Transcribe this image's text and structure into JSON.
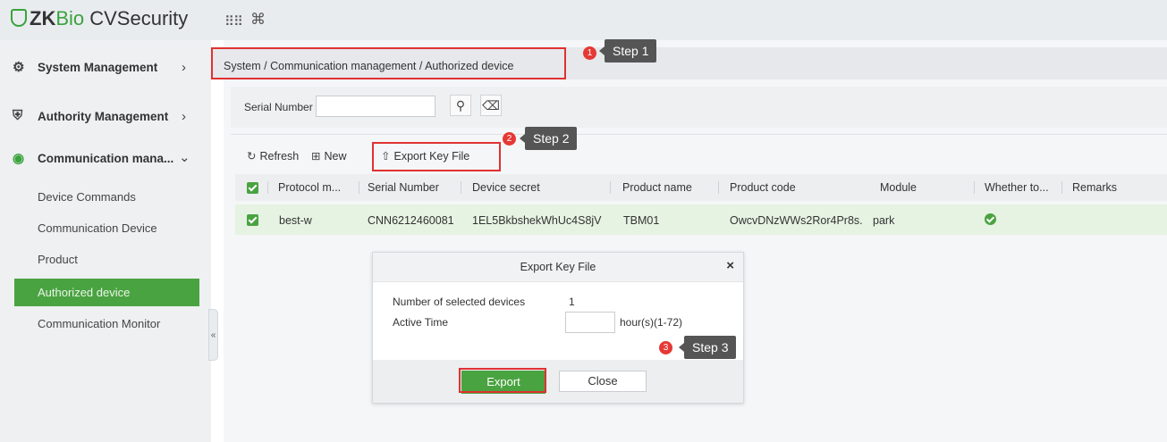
{
  "app": {
    "logo_zk": "ZK",
    "logo_bio": "Bio",
    "logo_rest": " CVSecurity",
    "grid_icon": "⠿⠿",
    "cmd_icon": "⌘"
  },
  "sidebar": {
    "menus": [
      {
        "label": "System Management",
        "icon": "gear-icon",
        "chevron": "›"
      },
      {
        "label": "Authority Management",
        "icon": "shield-icon",
        "chevron": "›"
      },
      {
        "label": "Communication mana...",
        "icon": "broadcast-icon",
        "chevron": "⌄"
      }
    ],
    "submenu": [
      {
        "label": "Device Commands"
      },
      {
        "label": "Communication Device"
      },
      {
        "label": "Product"
      },
      {
        "label": "Authorized device"
      },
      {
        "label": "Communication Monitor"
      }
    ],
    "collapse_label": "«"
  },
  "breadcrumb": "System / Communication management / Authorized device",
  "search": {
    "serial_label": "Serial Number",
    "serial_value": "",
    "search_icon": "⚲",
    "clear_icon": "⌫"
  },
  "toolbar": {
    "refresh": "Refresh",
    "new": "New",
    "export": "Export Key File"
  },
  "table": {
    "columns": [
      "Protocol m...",
      "Serial Number",
      "Device secret",
      "Product name",
      "Product code",
      "Module",
      "Whether to...",
      "Remarks"
    ],
    "rows": [
      {
        "protocol": "best-w",
        "serial": "CNN6212460081",
        "secret": "1EL5BkbshekWhUc4S8jV",
        "product_name": "TBM01",
        "product_code": "OwcvDNzWWs2Ror4Pr8s.",
        "module": "park",
        "whether": "enabled",
        "remarks": ""
      }
    ]
  },
  "dialog": {
    "title": "Export Key File",
    "close_icon": "×",
    "selected_label": "Number of selected devices",
    "selected_value": "1",
    "active_label": "Active Time",
    "active_value": "",
    "active_unit": "hour(s)(1-72)",
    "export_btn": "Export",
    "close_btn": "Close"
  },
  "annotations": {
    "step1": {
      "num": "1",
      "label": "Step 1"
    },
    "step2": {
      "num": "2",
      "label": "Step 2"
    },
    "step3": {
      "num": "3",
      "label": "Step 3"
    },
    "highlight_color": "#e03131"
  }
}
